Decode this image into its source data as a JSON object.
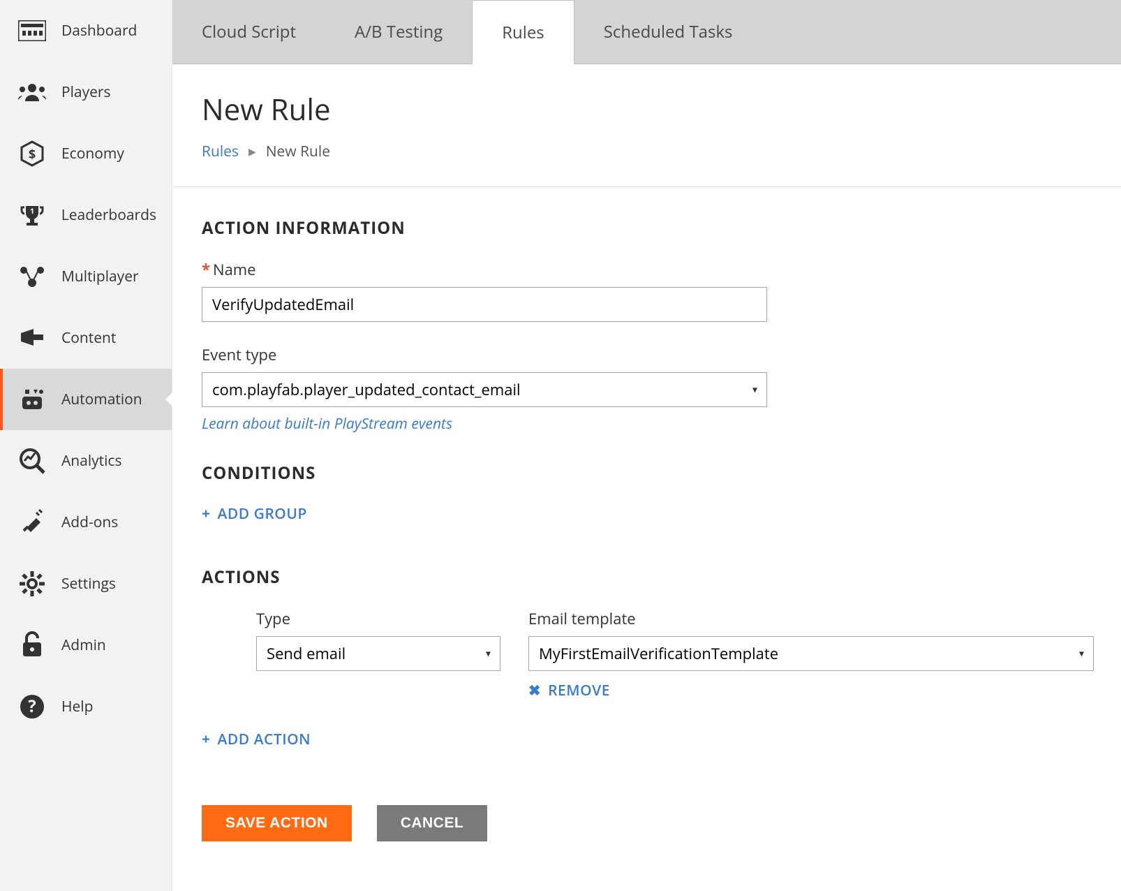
{
  "sidebar": {
    "items": [
      {
        "label": "Dashboard"
      },
      {
        "label": "Players"
      },
      {
        "label": "Economy"
      },
      {
        "label": "Leaderboards"
      },
      {
        "label": "Multiplayer"
      },
      {
        "label": "Content"
      },
      {
        "label": "Automation"
      },
      {
        "label": "Analytics"
      },
      {
        "label": "Add-ons"
      },
      {
        "label": "Settings"
      },
      {
        "label": "Admin"
      },
      {
        "label": "Help"
      }
    ]
  },
  "tabs": {
    "items": [
      {
        "label": "Cloud Script"
      },
      {
        "label": "A/B Testing"
      },
      {
        "label": "Rules"
      },
      {
        "label": "Scheduled Tasks"
      }
    ]
  },
  "page": {
    "title": "New Rule",
    "breadcrumb": {
      "parent": "Rules",
      "current": "New Rule"
    }
  },
  "section_action_info": {
    "title": "ACTION INFORMATION",
    "name_label": "Name",
    "name_value": "VerifyUpdatedEmail",
    "event_type_label": "Event type",
    "event_type_value": "com.playfab.player_updated_contact_email",
    "help_link": "Learn about built-in PlayStream events"
  },
  "section_conditions": {
    "title": "CONDITIONS",
    "add_group": "ADD GROUP"
  },
  "section_actions": {
    "title": "ACTIONS",
    "type_label": "Type",
    "type_value": "Send email",
    "template_label": "Email template",
    "template_value": "MyFirstEmailVerificationTemplate",
    "remove": "REMOVE",
    "add_action": "ADD ACTION"
  },
  "buttons": {
    "save": "SAVE ACTION",
    "cancel": "CANCEL"
  }
}
